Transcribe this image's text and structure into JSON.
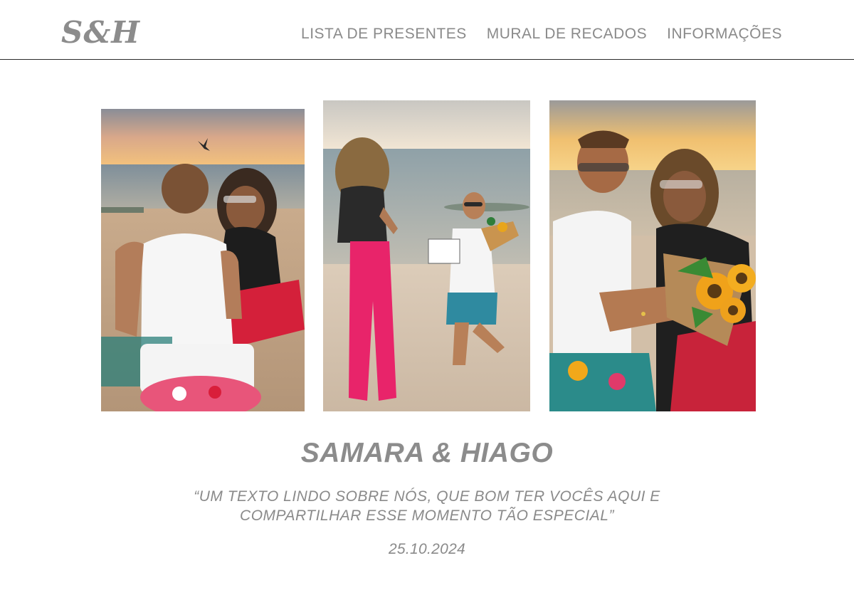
{
  "header": {
    "logo": "S&H",
    "nav": [
      {
        "label": "LISTA DE PRESENTES"
      },
      {
        "label": "MURAL DE RECADOS"
      },
      {
        "label": "INFORMAÇÕES"
      }
    ]
  },
  "hero": {
    "names": "SAMARA & HIAGO",
    "quote_line1": "“UM TEXTO LINDO SOBRE NÓS, QUE BOM TER VOCÊS AQUI E",
    "quote_line2": "COMPARTILHAR ESSE MOMENTO TÃO ESPECIAL”",
    "date": "25.10.2024"
  },
  "colors": {
    "text_gray": "#8a8a8a",
    "header_border": "#2b2b2b",
    "background": "#ffffff"
  }
}
